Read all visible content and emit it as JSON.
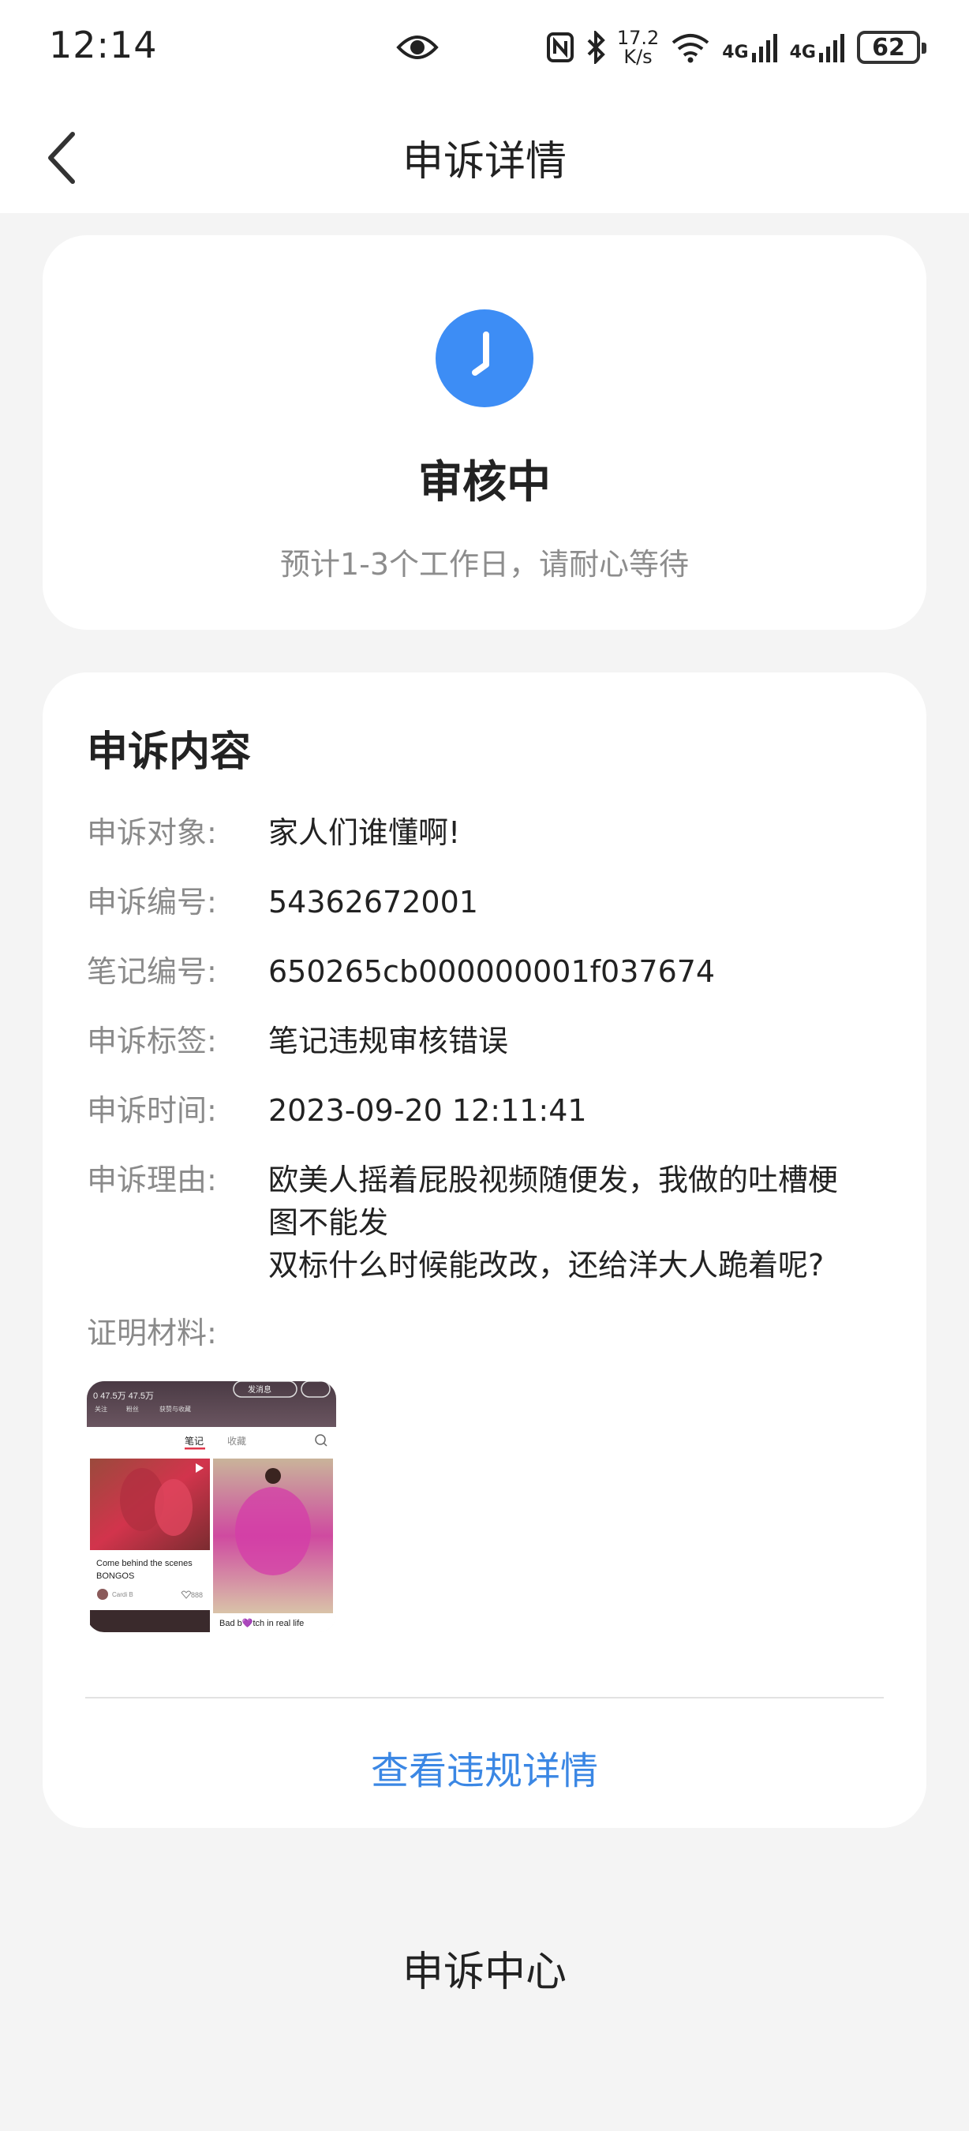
{
  "status_bar": {
    "time": "12:14",
    "speed_value": "17.2",
    "speed_unit": "K/s",
    "net1": "4G",
    "net2": "4G",
    "battery": "62"
  },
  "nav": {
    "title": "申诉详情"
  },
  "status": {
    "title": "审核中",
    "subtitle": "预计1-3个工作日，请耐心等待",
    "icon_color": "#3d8df5"
  },
  "content": {
    "title": "申诉内容",
    "rows": [
      {
        "label": "申诉对象:",
        "value": "家人们谁懂啊!"
      },
      {
        "label": "申诉编号:",
        "value": "54362672001"
      },
      {
        "label": "笔记编号:",
        "value": "650265cb000000001f037674"
      },
      {
        "label": "申诉标签:",
        "value": "笔记违规审核错误"
      },
      {
        "label": "申诉时间:",
        "value": "2023-09-20 12:11:41"
      }
    ],
    "reason": {
      "label": "申诉理由:",
      "line1": "欧美人摇着屁股视频随便发，我做的吐槽梗",
      "line2": "图不能发",
      "line3": "双标什么时候能改改，还给洋大人跪着呢?"
    },
    "proof_label": "证明材料:",
    "proof_thumb": {
      "tab_notes": "笔记",
      "tab_saved": "收藏",
      "follow_label": "关注",
      "fans_label": "粉丝",
      "likes_label": "获赞与收藏",
      "message_btn": "发消息",
      "card1_caption_1": "Come behind the scenes",
      "card1_caption_2": "BONGOS",
      "card1_author": "Cardi B",
      "card1_likes": "888",
      "card2_caption": "Bad b💜tch in real life"
    },
    "link": "查看违规详情"
  },
  "footer": {
    "label": "申诉中心"
  }
}
